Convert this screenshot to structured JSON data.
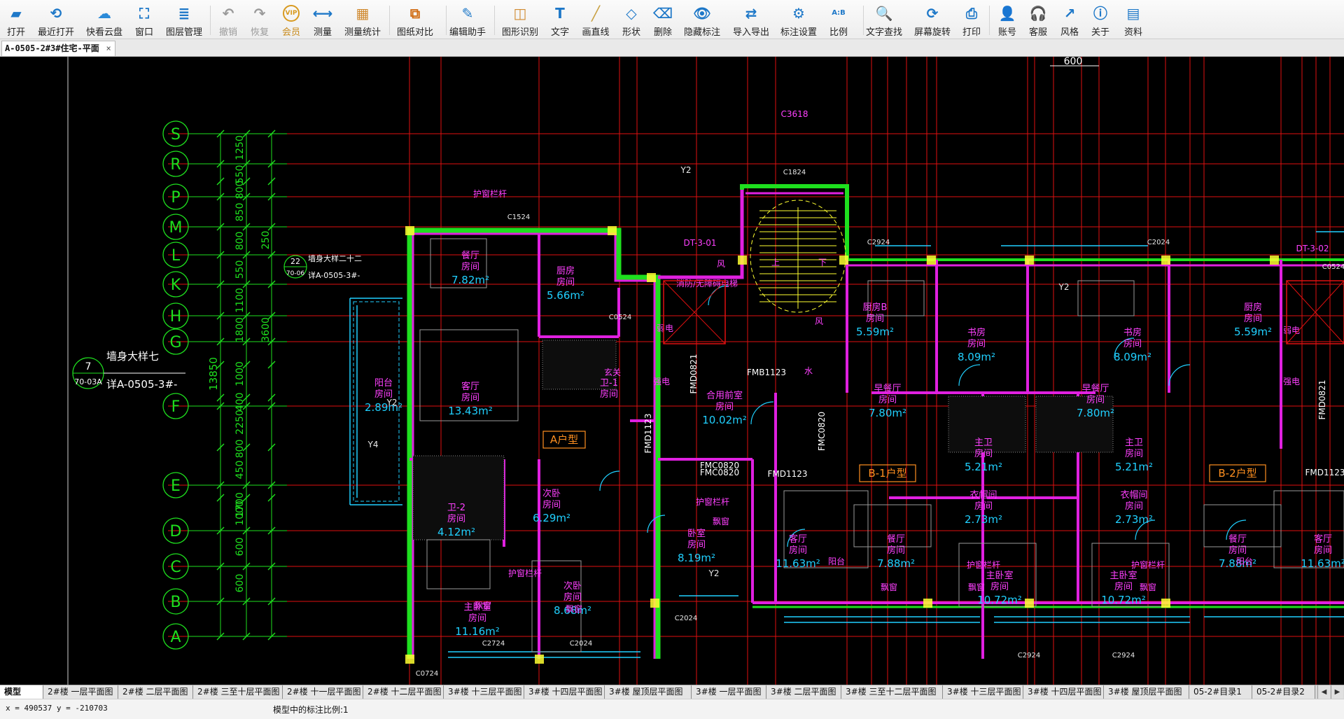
{
  "toolbar": {
    "buttons": [
      {
        "label": "打开",
        "icon": "folder-open-icon"
      },
      {
        "label": "最近打开",
        "icon": "recent-clock-icon"
      },
      {
        "label": "快看云盘",
        "icon": "cloud-icon"
      },
      {
        "label": "窗口",
        "icon": "window-icon"
      },
      {
        "label": "图层管理",
        "icon": "layers-icon"
      },
      {
        "label": "撤销",
        "icon": "undo-icon"
      },
      {
        "label": "恢复",
        "icon": "redo-icon"
      },
      {
        "label": "会员",
        "icon": "vip-icon",
        "badge": "VIP"
      },
      {
        "label": "测量",
        "icon": "measure-icon"
      },
      {
        "label": "测量统计",
        "icon": "measure-stats-icon"
      },
      {
        "label": "图纸对比",
        "icon": "compare-icon"
      },
      {
        "label": "编辑助手",
        "icon": "edit-assistant-icon"
      },
      {
        "label": "图形识别",
        "icon": "shape-recognize-icon"
      },
      {
        "label": "文字",
        "icon": "text-icon"
      },
      {
        "label": "画直线",
        "icon": "line-icon"
      },
      {
        "label": "形状",
        "icon": "shape-icon"
      },
      {
        "label": "删除",
        "icon": "eraser-icon"
      },
      {
        "label": "隐藏标注",
        "icon": "hide-eye-icon"
      },
      {
        "label": "导入导出",
        "icon": "import-export-icon"
      },
      {
        "label": "标注设置",
        "icon": "annotation-settings-icon"
      },
      {
        "label": "比例",
        "icon": "scale-icon"
      },
      {
        "label": "文字查找",
        "icon": "text-search-icon"
      },
      {
        "label": "屏幕旋转",
        "icon": "rotate-icon"
      },
      {
        "label": "打印",
        "icon": "print-icon"
      },
      {
        "label": "账号",
        "icon": "account-icon"
      },
      {
        "label": "客服",
        "icon": "headset-icon"
      },
      {
        "label": "风格",
        "icon": "style-icon"
      },
      {
        "label": "关于",
        "icon": "info-icon"
      },
      {
        "label": "资料",
        "icon": "materials-icon"
      }
    ]
  },
  "document_tab": {
    "title": "A-0505-2#3#住宅-平面",
    "close": "×"
  },
  "drawing": {
    "axis_labels": [
      "S",
      "R",
      "P",
      "M",
      "L",
      "K",
      "H",
      "G",
      "F",
      "E",
      "D",
      "C",
      "B",
      "A"
    ],
    "dims_outer": [
      "1250",
      "550",
      "800",
      "850",
      "800",
      "550",
      "1100",
      "1800",
      "1000",
      "400",
      "2250",
      "800",
      "450",
      "1700",
      "1000",
      "600",
      "600"
    ],
    "dims_mid": [
      "250",
      "3600"
    ],
    "dim_total": "13850",
    "dim_top": "600",
    "detail_callouts": [
      {
        "num": "7",
        "ref": "70-03A",
        "title": "墙身大样七",
        "link": "详A-0505-3#-"
      },
      {
        "num": "22",
        "ref": "70-06",
        "title": "墙身大样二十二",
        "link": "详A-0505-3#-"
      }
    ],
    "rooms": [
      {
        "name": "餐厅",
        "sub": "房间",
        "area": "7.82m²"
      },
      {
        "name": "厨房",
        "sub": "房间",
        "area": "5.66m²"
      },
      {
        "name": "客厅",
        "sub": "房间",
        "area": "13.43m²"
      },
      {
        "name": "阳台",
        "sub": "房间",
        "area": "2.89m²"
      },
      {
        "name": "卫-1",
        "sub": "房间",
        "area": ""
      },
      {
        "name": "卫-2",
        "sub": "房间",
        "area": "4.12m²"
      },
      {
        "name": "次卧",
        "sub": "房间",
        "area": "6.29m²"
      },
      {
        "name": "次卧",
        "sub": "房间",
        "area": "8.68m²"
      },
      {
        "name": "主卧室",
        "sub": "房间",
        "area": "11.16m²"
      },
      {
        "name": "卧室",
        "sub": "房间",
        "area": "8.19m²"
      },
      {
        "name": "合用前室",
        "sub": "房间",
        "area": "10.02m²"
      },
      {
        "name": "厨房B",
        "sub": "房间",
        "area": "5.59m²"
      },
      {
        "name": "书房",
        "sub": "房间",
        "area": "8.09m²"
      },
      {
        "name": "书房",
        "sub": "房间",
        "area": "8.09m²"
      },
      {
        "name": "早餐厅",
        "sub": "房间",
        "area": "7.80m²"
      },
      {
        "name": "早餐厅",
        "sub": "房间",
        "area": "7.80m²"
      },
      {
        "name": "主卫",
        "sub": "房间",
        "area": "5.21m²"
      },
      {
        "name": "主卫",
        "sub": "房间",
        "area": "5.21m²"
      },
      {
        "name": "衣帽间",
        "sub": "房间",
        "area": "2.73m²"
      },
      {
        "name": "衣帽间",
        "sub": "房间",
        "area": "2.73m²"
      },
      {
        "name": "客厅",
        "sub": "房间",
        "area": "11.63m²"
      },
      {
        "name": "餐厅",
        "sub": "房间",
        "area": "7.88m²"
      },
      {
        "name": "主卧室",
        "sub": "房间",
        "area": "10.72m²"
      },
      {
        "name": "主卧室",
        "sub": "房间",
        "area": "10.72m²"
      },
      {
        "name": "餐厅",
        "sub": "房间",
        "area": "7.88m²"
      },
      {
        "name": "客厅",
        "sub": "房间",
        "area": "11.63m²"
      },
      {
        "name": "厨房",
        "sub": "房间",
        "area": "5.59m²"
      }
    ],
    "unit_tags": [
      "A户型",
      "B-1户型",
      "B-2户型"
    ],
    "door_tags": [
      "FMB1123",
      "FMC0820",
      "FMD1123",
      "FMD1123",
      "FMC0820",
      "FMD1123",
      "FMD0821",
      "FMD0821",
      "FMC0820"
    ],
    "window_tags": [
      "C1524",
      "C0524",
      "C2724",
      "C2024",
      "C0724",
      "C1824",
      "C2024",
      "C2924",
      "C2924",
      "C0524",
      "C2924",
      "C2024"
    ],
    "misc_labels": [
      "护窗栏杆",
      "护窗栏杆",
      "护窗栏杆",
      "护窗栏杆",
      "护窗栏杆",
      "飘窗",
      "飘窗",
      "飘窗",
      "飘窗",
      "飘窗",
      "飘窗",
      "阳台",
      "阳台",
      "风",
      "风",
      "水",
      "弱电",
      "弱电",
      "强电",
      "强电",
      "玄关",
      "上",
      "下",
      "Y2",
      "Y2",
      "Y2",
      "Y4",
      "Y2",
      "DT-3-01",
      "DT-3-02",
      "消防/无障碍电梯",
      "C3618"
    ]
  },
  "layout_tabs": [
    "模型",
    "2#楼 一层平面图",
    "2#楼 二层平面图",
    "2#楼 三至十层平面图",
    "2#楼 十一层平面图",
    "2#楼 十二层平面图",
    "3#楼 十三层平面图",
    "3#楼 十四层平面图",
    "3#楼 屋顶层平面图",
    "3#楼 一层平面图",
    "3#楼 二层平面图",
    "3#楼 三至十二层平面图",
    "3#楼 十三层平面图",
    "3#楼 十四层平面图",
    "3#楼 屋顶层平面图",
    "05-2#目录1",
    "05-2#目录2"
  ],
  "status": {
    "coords": "x = 490537 y = -210703",
    "scale": "模型中的标注比例:1"
  },
  "colors": {
    "canvas_bg": "#000000",
    "grid_red": "#e01010",
    "axis_green": "#1ee01e",
    "wall_magenta": "#e020e0",
    "text_magenta": "#ff40ff",
    "cyan": "#20d0ff",
    "yellow": "#ffff30",
    "white": "#e8e8e8",
    "orange": "#ff9020"
  }
}
